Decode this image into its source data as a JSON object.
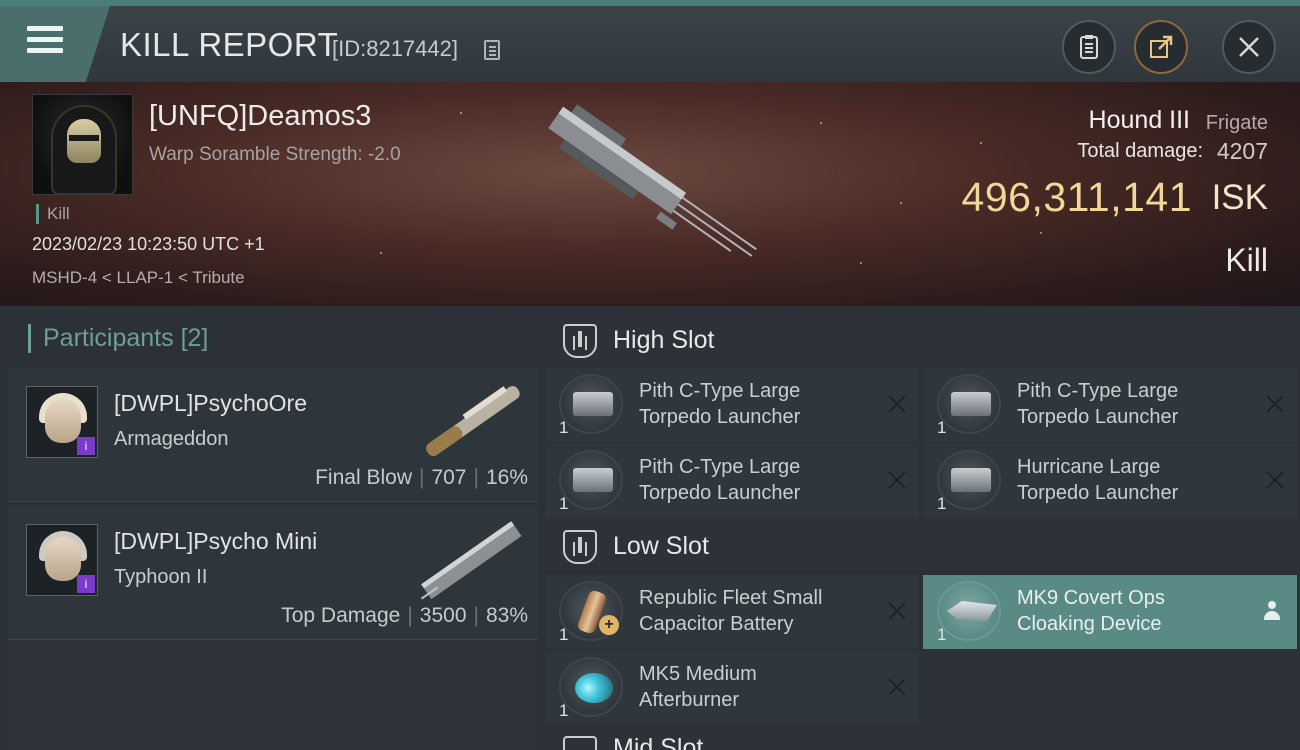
{
  "header": {
    "title": "KILL REPORT",
    "report_id": "[ID:8217442]",
    "menu_icon": "hamburger-icon",
    "buttons": [
      "clipboard-icon",
      "share-icon",
      "close-icon"
    ]
  },
  "victim": {
    "name": "[UNFQ]Deamos3",
    "warp_scramble": "Warp Soramble Strength: -2.0",
    "kill_tag": "Kill",
    "timestamp": "2023/02/23 10:23:50 UTC +1",
    "location": "MSHD-4 < LLAP-1 < Tribute",
    "ship_name": "Hound III",
    "ship_class": "Frigate",
    "total_damage_label": "Total damage:",
    "total_damage": "4207",
    "isk_value": "496,311,141",
    "isk_label": "ISK",
    "result": "Kill"
  },
  "participants": {
    "label": "Participants",
    "count": "[2]",
    "items": [
      {
        "name": "[DWPL]PsychoOre",
        "ship": "Armageddon",
        "role": "Final Blow",
        "damage": "707",
        "percent": "16%"
      },
      {
        "name": "[DWPL]Psycho Mini",
        "ship": "Typhoon II",
        "role": "Top Damage",
        "damage": "3500",
        "percent": "83%"
      }
    ]
  },
  "slots": {
    "high": {
      "title": "High Slot",
      "modules": [
        {
          "line1": "Pith C-Type Large",
          "line2": "Torpedo Launcher",
          "qty": "1"
        },
        {
          "line1": "Pith C-Type Large",
          "line2": "Torpedo Launcher",
          "qty": "1"
        },
        {
          "line1": "Pith C-Type Large",
          "line2": "Torpedo Launcher",
          "qty": "1"
        },
        {
          "line1": "Hurricane Large",
          "line2": "Torpedo Launcher",
          "qty": "1"
        }
      ]
    },
    "low": {
      "title": "Low Slot",
      "modules": [
        {
          "line1": "Republic Fleet Small",
          "line2": "Capacitor Battery",
          "qty": "1"
        },
        {
          "line1": "MK9 Covert Ops",
          "line2": "Cloaking Device",
          "qty": "1"
        },
        {
          "line1": "MK5 Medium",
          "line2": "Afterburner",
          "qty": "1"
        }
      ]
    },
    "mid": {
      "title": "Mid Slot"
    }
  },
  "colors": {
    "accent_teal": "#5a8a86",
    "isk_gold": "#f1d79a",
    "corp_badge": "#7a3bc8"
  }
}
